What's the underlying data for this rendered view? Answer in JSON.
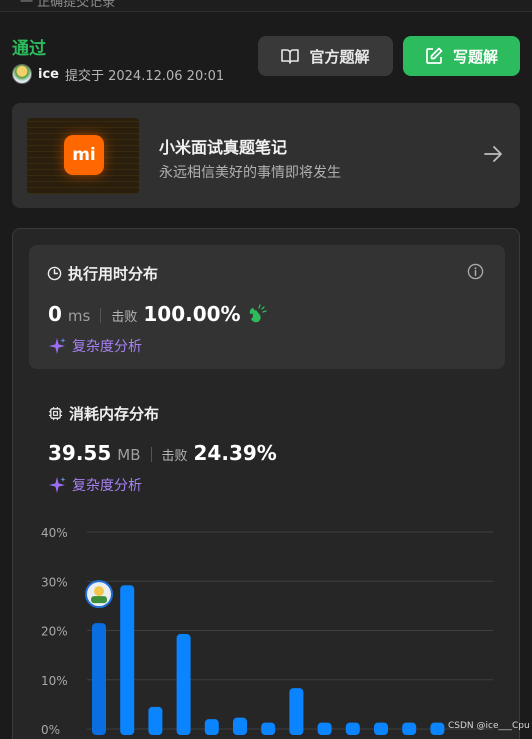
{
  "top_strip": {
    "text": "一 正确提交记录"
  },
  "status": {
    "text": "通过",
    "color": "#2cbb5d"
  },
  "submission": {
    "username": "ice",
    "submitted_at": "提交于 2024.12.06 20:01"
  },
  "buttons": {
    "official_solution": "官方题解",
    "write_solution": "写题解"
  },
  "promo": {
    "logo_text": "mi",
    "title": "小米面试真题笔记",
    "subtitle": "永远相信美好的事情即将发生"
  },
  "runtime": {
    "title": "执行用时分布",
    "value": "0",
    "unit": "ms",
    "beat_label": "击败",
    "beat_pct": "100.00%",
    "analyze_label": "复杂度分析"
  },
  "memory": {
    "title": "消耗内存分布",
    "value": "39.55",
    "unit": "MB",
    "beat_label": "击败",
    "beat_pct": "24.39%",
    "analyze_label": "复杂度分析"
  },
  "chart_data": {
    "type": "bar",
    "title": "",
    "xlabel": "",
    "ylabel": "",
    "y_ticks": [
      "40%",
      "30%",
      "20%",
      "10%",
      "0%"
    ],
    "ylim": [
      0,
      40
    ],
    "values": [
      21.5,
      29.2,
      4.5,
      19.3,
      2.0,
      2.3,
      1.3,
      8.3,
      1.3,
      1.3,
      1.3,
      1.3,
      1.3
    ],
    "highlight_index": 0,
    "bar_color": "#0a84ff",
    "highlight_color": "#0a6ee0"
  },
  "watermark": "CSDN @ice___Cpu"
}
